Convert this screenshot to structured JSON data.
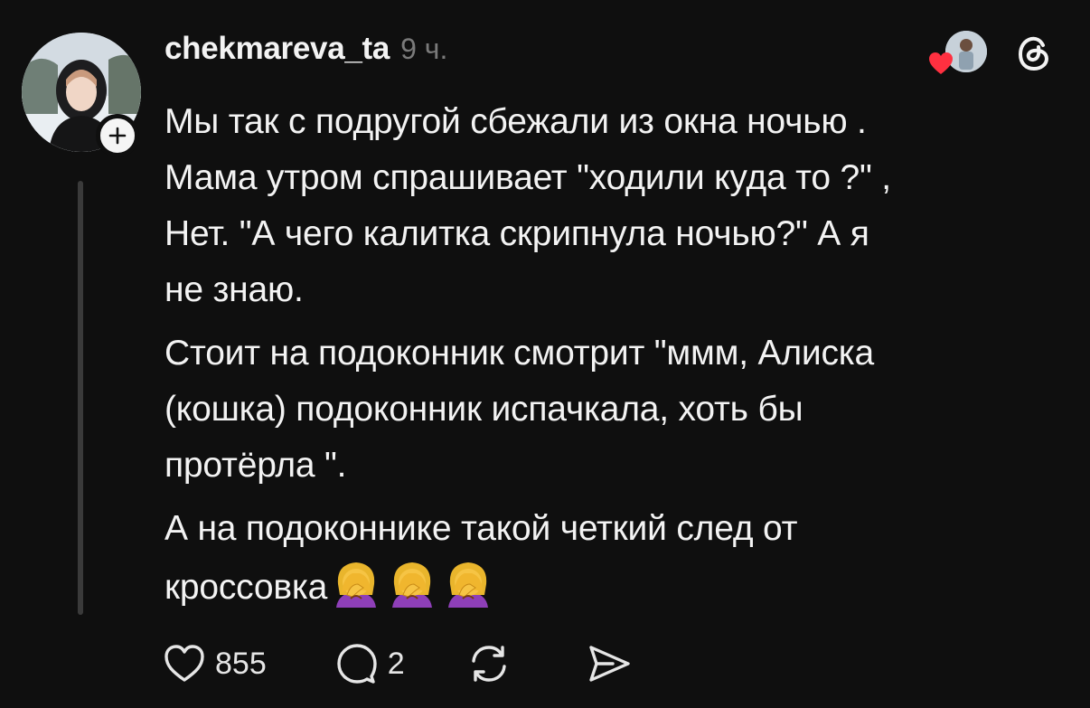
{
  "post": {
    "username": "chekmareva_ta",
    "timestamp": "9 ч.",
    "paragraphs": [
      "Мы так с подругой сбежали из окна ночью .\nМама утром спрашивает \"ходили куда то ?\" ,\nНет. \"А чего калитка скрипнула ночью?\" А я\nне знаю.",
      "Стоит на подоконник смотрит \"ммм, Алиска\n(кошка) подоконник испачкала, хоть бы\nпротёрла \".",
      "А на подоконнике такой четкий след от\nкроссовка"
    ],
    "emoji": [
      "woman-facepalming-emoji",
      "woman-facepalming-emoji",
      "woman-facepalming-emoji"
    ]
  },
  "actions": {
    "likes": "855",
    "comments": "2"
  },
  "icons": {
    "follow": "plus-icon",
    "like": "heart-outline-icon",
    "comment": "speech-bubble-icon",
    "repost": "repost-arrows-icon",
    "share": "send-plane-icon",
    "brand": "threads-logo-icon"
  },
  "colors": {
    "background": "#0f0f0f",
    "text": "#f3f3f3",
    "muted": "#7a7a7a",
    "heart": "#ff3040"
  }
}
